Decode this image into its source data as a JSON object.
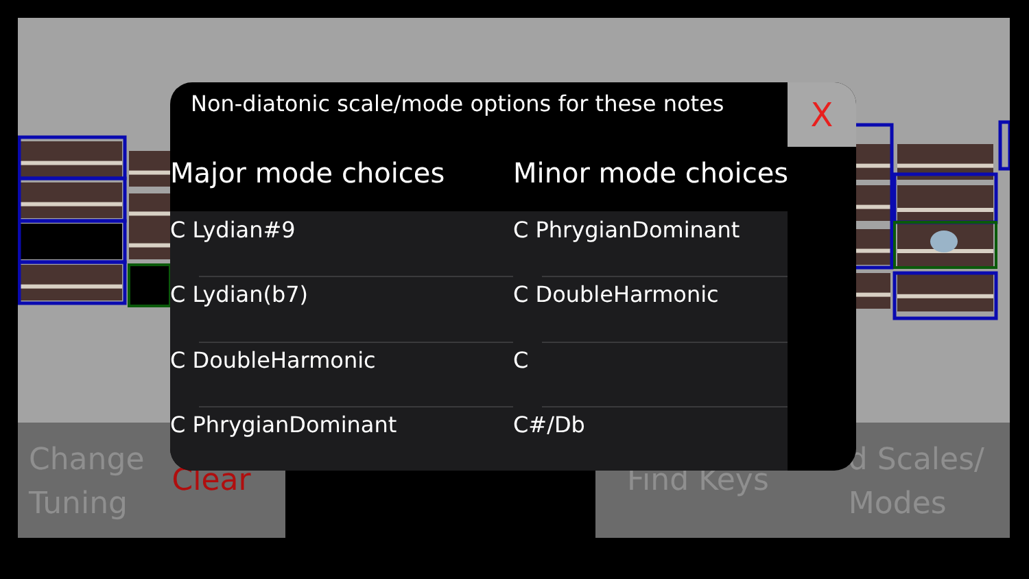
{
  "bottom_bar": {
    "change_tuning": [
      "Change",
      "Tuning"
    ],
    "clear": "Clear",
    "find_keys": "Find Keys",
    "find_scales": [
      "d Scales/",
      "Modes"
    ]
  },
  "dialog": {
    "title": "Non-diatonic scale/mode options for these notes",
    "close": "X",
    "columns": [
      {
        "heading": "Major mode choices",
        "items": [
          "C Lydian#9",
          "C Lydian(b7)",
          "C DoubleHarmonic",
          "C PhrygianDominant"
        ]
      },
      {
        "heading": "Minor mode choices",
        "items": [
          "C PhrygianDominant",
          "C DoubleHarmonic",
          "C",
          "C#/Db"
        ]
      }
    ]
  }
}
